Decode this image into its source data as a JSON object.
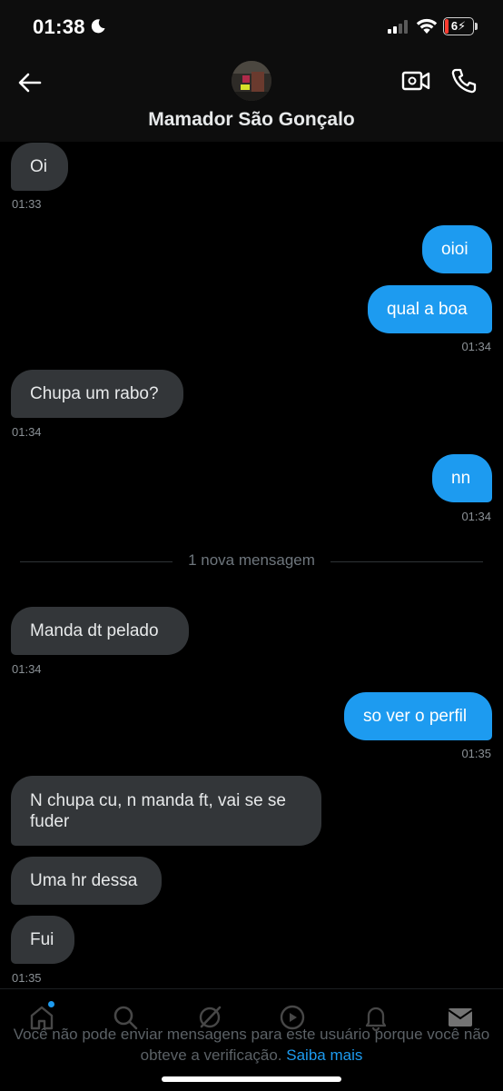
{
  "status_bar": {
    "time": "01:38",
    "battery": "6"
  },
  "header": {
    "contact_name": "Mamador São Gonçalo"
  },
  "messages": [
    {
      "text": "Oi",
      "time": "01:33"
    },
    {
      "text": "oioi"
    },
    {
      "text": "qual a boa",
      "time": "01:34"
    },
    {
      "text": "Chupa um rabo?",
      "time": "01:34"
    },
    {
      "text": "nn",
      "time": "01:34"
    },
    {
      "text": "Manda dt pelado",
      "time": "01:34"
    },
    {
      "text": "so ver o perfil",
      "time": "01:35"
    },
    {
      "text": "N chupa cu, n manda ft, vai se se fuder"
    },
    {
      "text": "Uma hr dessa"
    },
    {
      "text": "Fui",
      "time": "01:35"
    }
  ],
  "divider": "1 nova mensagem",
  "footer": {
    "notice": "Você não pode enviar mensagens para este usuário porque você não obteve a verificação.",
    "link": "Saiba mais"
  },
  "icons": [
    "back-arrow-icon",
    "video-call-icon",
    "phone-icon",
    "home-icon",
    "search-icon",
    "grok-icon",
    "video-icon",
    "bell-icon",
    "mail-icon"
  ],
  "colors": {
    "accent": "#1d9bf0",
    "incoming_bubble": "#333639",
    "background": "#000000"
  }
}
